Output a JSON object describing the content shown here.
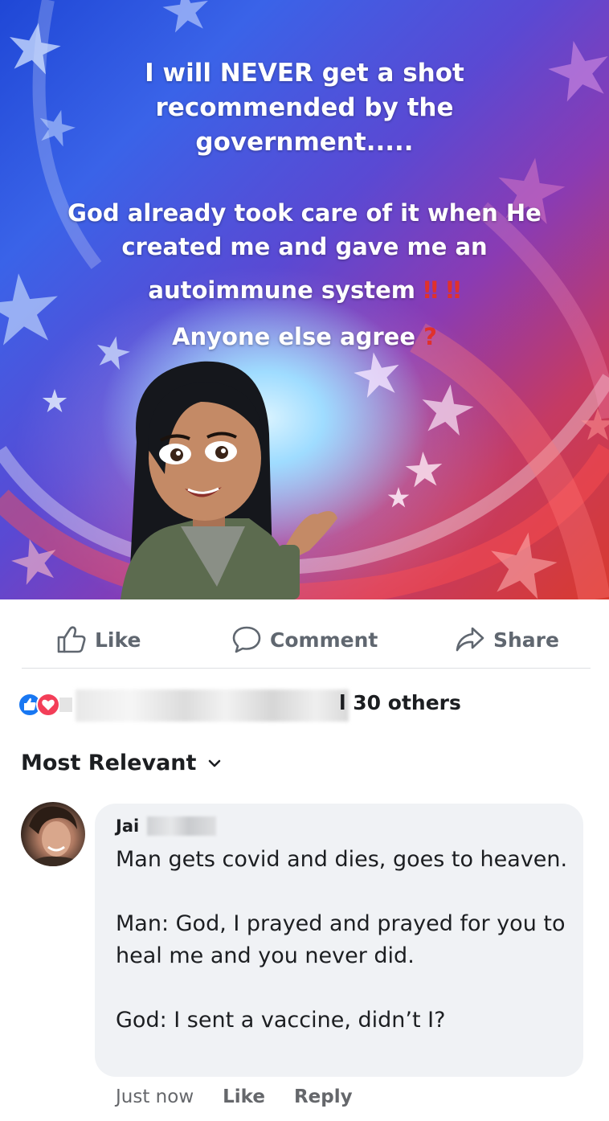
{
  "post": {
    "text_line1": "I will NEVER get a shot",
    "text_line2": "recommended by the",
    "text_line3": "government.....",
    "text_line4": "God already took care of it when He",
    "text_line5": "created me and gave me an",
    "text_line6": "autoimmune system",
    "text_line6_emphasis": "‼ ‼",
    "text_line7": "Anyone else agree",
    "text_line7_emphasis": "?",
    "background_colors": [
      "#1f47d6",
      "#8a3bb3",
      "#d93a2e"
    ]
  },
  "actions": {
    "like_label": "Like",
    "comment_label": "Comment",
    "share_label": "Share"
  },
  "reactions": {
    "summary_suffix": "l 30 others",
    "icons": [
      "like-icon",
      "love-icon"
    ]
  },
  "sort": {
    "label": "Most Relevant"
  },
  "comment": {
    "author_visible": "Jai",
    "paragraph1": "Man gets covid and dies, goes to heaven.",
    "paragraph2": "Man: God, I prayed and prayed for you to heal me and you never did.",
    "paragraph3": "God: I sent a vaccine, didn’t I?",
    "time": "Just now",
    "like_label": "Like",
    "reply_label": "Reply"
  },
  "colors": {
    "action_text": "#606770",
    "bubble_bg": "#f0f2f5",
    "meta_text": "#65676b",
    "like_blue": "#1877f2",
    "love_red": "#f33e58"
  }
}
